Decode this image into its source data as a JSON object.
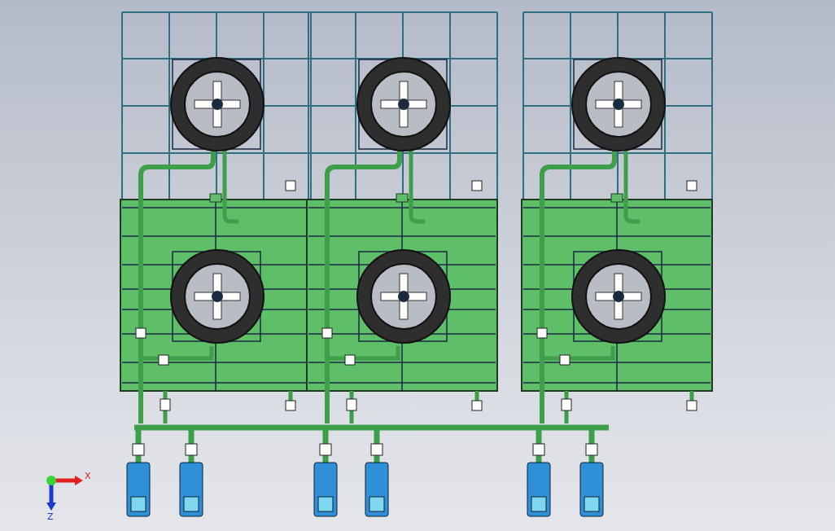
{
  "triad": {
    "x_label": "X",
    "z_label": "Z"
  }
}
